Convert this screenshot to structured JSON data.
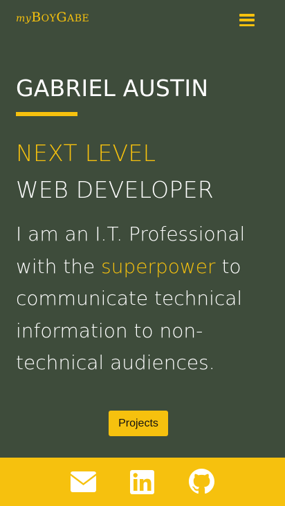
{
  "header": {
    "logo": {
      "prefix": "my",
      "b": "B",
      "oy": "OY",
      "g": "G",
      "abe": "ABE"
    },
    "menu_icon": "hamburger-menu-icon"
  },
  "hero": {
    "name": "GABRIEL AUSTIN",
    "tagline_accent": "NEXT LEVEL",
    "tagline_main": "WEB DEVELOPER",
    "bio": {
      "part1": "I am an I.T. Professional with the ",
      "highlight": "superpower",
      "part2": " to communicate technical information to non-technical audiences."
    },
    "projects_label": "Projects"
  },
  "footer": {
    "icons": [
      "email-icon",
      "linkedin-icon",
      "github-icon"
    ]
  },
  "colors": {
    "background": "#3e4c3b",
    "accent": "#f6c10e",
    "text": "#ffffff"
  }
}
